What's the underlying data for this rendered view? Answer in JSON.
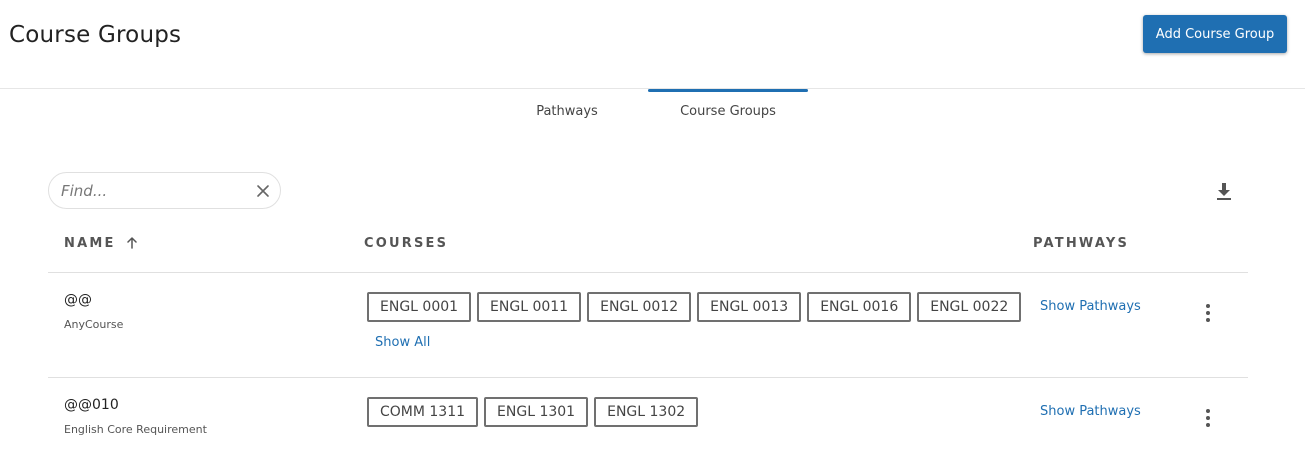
{
  "header": {
    "title": "Course Groups",
    "add_button_label": "Add Course Group"
  },
  "tabs": [
    {
      "label": "Pathways",
      "active": false
    },
    {
      "label": "Course Groups",
      "active": true
    }
  ],
  "search": {
    "placeholder": "Find...",
    "value": ""
  },
  "table": {
    "columns": {
      "name": "NAME",
      "courses": "COURSES",
      "pathways": "PATHWAYS"
    },
    "sort": {
      "column": "name",
      "direction": "ascending"
    },
    "rows": [
      {
        "name": "@@",
        "description": "AnyCourse",
        "courses": [
          "ENGL 0001",
          "ENGL 0011",
          "ENGL 0012",
          "ENGL 0013",
          "ENGL 0016",
          "ENGL 0022"
        ],
        "show_all_label": "Show All",
        "pathways_link": "Show Pathways"
      },
      {
        "name": "@@010",
        "description": "English Core Requirement",
        "courses": [
          "COMM 1311",
          "ENGL 1301",
          "ENGL 1302"
        ],
        "pathways_link": "Show Pathways"
      }
    ]
  },
  "colors": {
    "accent": "#1f6fb2",
    "chip_border": "#707070",
    "divider": "#e0e0e0"
  },
  "icons": [
    "close-icon",
    "download-icon",
    "sort-arrow-up-icon",
    "more-vertical-icon"
  ]
}
